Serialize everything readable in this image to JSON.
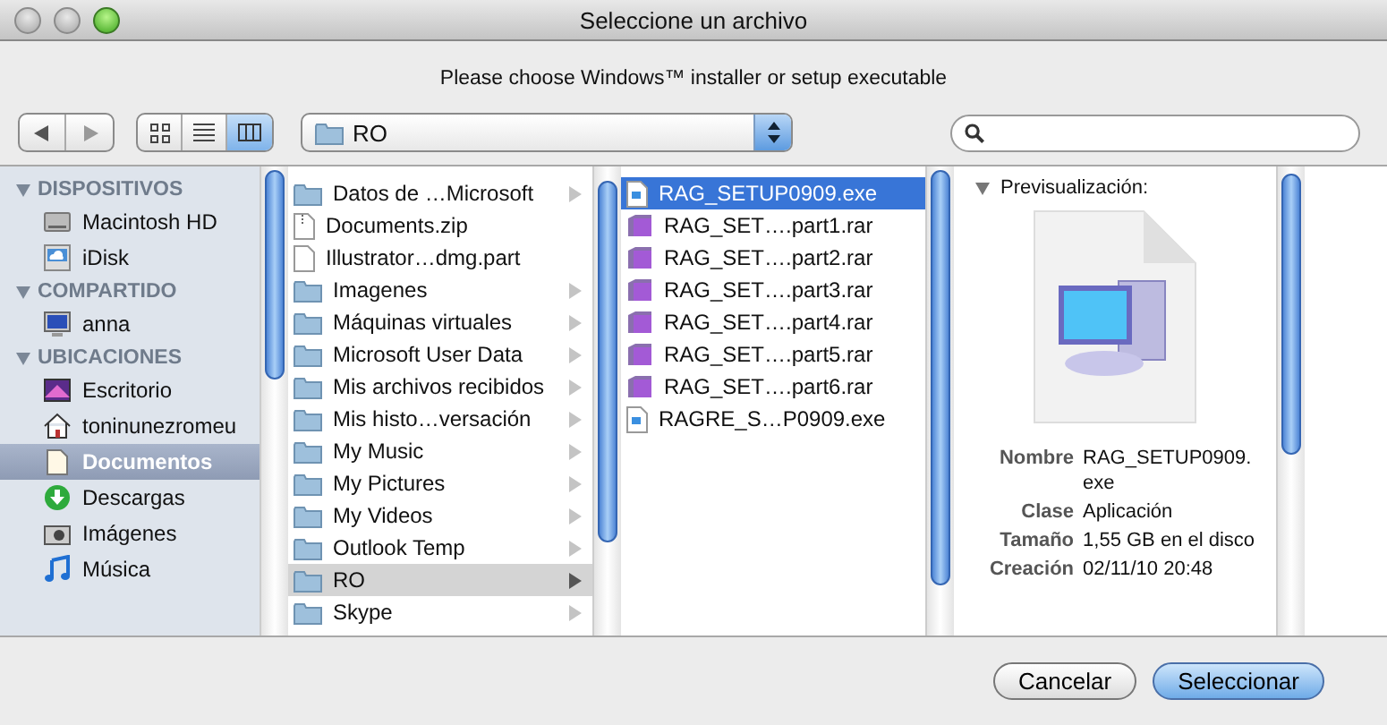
{
  "window": {
    "title": "Seleccione un archivo"
  },
  "message": "Please choose Windows™ installer or setup executable",
  "toolbar": {
    "view_modes": [
      {
        "kind": "icons",
        "selected": false
      },
      {
        "kind": "list",
        "selected": false
      },
      {
        "kind": "columns",
        "selected": true
      }
    ],
    "path_popup": {
      "label": "RO"
    }
  },
  "sidebar": {
    "sections": [
      {
        "title": "DISPOSITIVOS",
        "items": [
          {
            "label": "Macintosh HD",
            "kind": "disk",
            "selected": false
          },
          {
            "label": "iDisk",
            "kind": "idisk",
            "selected": false
          }
        ]
      },
      {
        "title": "COMPARTIDO",
        "items": [
          {
            "label": "anna",
            "kind": "computer",
            "selected": false
          }
        ]
      },
      {
        "title": "UBICACIONES",
        "items": [
          {
            "label": "Escritorio",
            "kind": "desktop",
            "selected": false
          },
          {
            "label": "toninunezromeu",
            "kind": "home",
            "selected": false
          },
          {
            "label": "Documentos",
            "kind": "documents",
            "selected": true
          },
          {
            "label": "Descargas",
            "kind": "downloads",
            "selected": false
          },
          {
            "label": "Imágenes",
            "kind": "pictures",
            "selected": false
          },
          {
            "label": "Música",
            "kind": "music",
            "selected": false
          }
        ]
      }
    ]
  },
  "columns": [
    {
      "focused": false,
      "items": [
        {
          "label": "Datos de …Microsoft",
          "kind": "folder",
          "selected": false
        },
        {
          "label": "Documents.zip",
          "kind": "zip",
          "selected": false
        },
        {
          "label": "Illustrator…dmg.part",
          "kind": "file",
          "selected": false
        },
        {
          "label": "Imagenes",
          "kind": "folder",
          "selected": false
        },
        {
          "label": "Máquinas virtuales",
          "kind": "folder",
          "selected": false
        },
        {
          "label": "Microsoft User Data",
          "kind": "folder",
          "selected": false
        },
        {
          "label": "Mis archivos recibidos",
          "kind": "folder",
          "selected": false
        },
        {
          "label": "Mis histo…versación",
          "kind": "folder",
          "selected": false
        },
        {
          "label": "My Music",
          "kind": "folder",
          "selected": false
        },
        {
          "label": "My Pictures",
          "kind": "folder",
          "selected": false
        },
        {
          "label": "My Videos",
          "kind": "folder",
          "selected": false
        },
        {
          "label": "Outlook Temp",
          "kind": "folder",
          "selected": false
        },
        {
          "label": "RO",
          "kind": "folder",
          "selected": true
        },
        {
          "label": "Skype",
          "kind": "folder",
          "selected": false
        }
      ]
    },
    {
      "focused": true,
      "items": [
        {
          "label": "RAG_SETUP0909.exe",
          "kind": "exe",
          "selected": true
        },
        {
          "label": "RAG_SET….part1.rar",
          "kind": "rar",
          "selected": false
        },
        {
          "label": "RAG_SET….part2.rar",
          "kind": "rar",
          "selected": false
        },
        {
          "label": "RAG_SET….part3.rar",
          "kind": "rar",
          "selected": false
        },
        {
          "label": "RAG_SET….part4.rar",
          "kind": "rar",
          "selected": false
        },
        {
          "label": "RAG_SET….part5.rar",
          "kind": "rar",
          "selected": false
        },
        {
          "label": "RAG_SET….part6.rar",
          "kind": "rar",
          "selected": false
        },
        {
          "label": "RAGRE_S…P0909.exe",
          "kind": "exe",
          "selected": false
        }
      ]
    }
  ],
  "preview": {
    "heading": "Previsualización:",
    "info": [
      {
        "label": "Nombre",
        "value": "RAG_SETUP0909. exe"
      },
      {
        "label": "Clase",
        "value": "Aplicación"
      },
      {
        "label": "Tamaño",
        "value": "1,55 GB en el disco"
      },
      {
        "label": "Creación",
        "value": "02/11/10 20:48"
      }
    ]
  },
  "buttons": [
    {
      "label": "Cancelar",
      "default": false
    },
    {
      "label": "Seleccionar",
      "default": true
    }
  ]
}
